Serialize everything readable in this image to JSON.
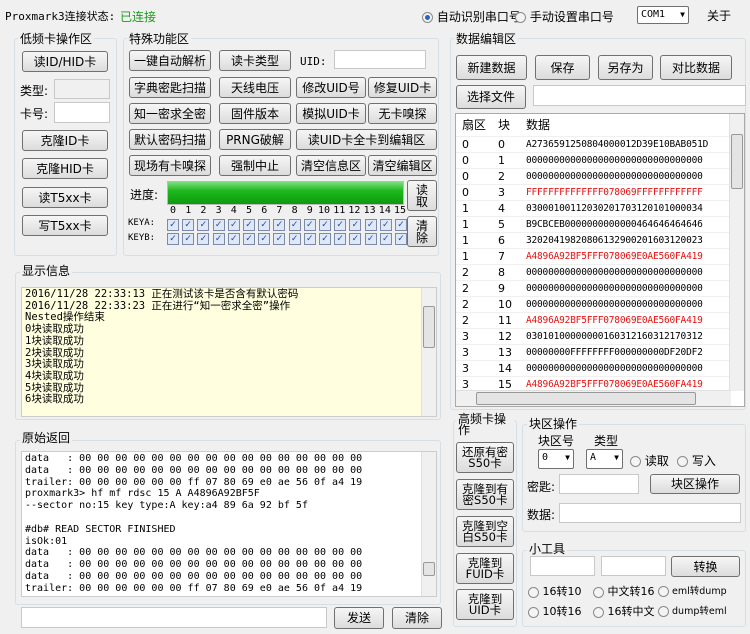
{
  "status": {
    "label": "Proxmark3连接状态:",
    "value": "已连接",
    "color": "#1c9a1c"
  },
  "port": {
    "auto_label": "自动识别串口号",
    "manual_label": "手动设置串口号",
    "selected": "COM1",
    "about": "关于"
  },
  "lf": {
    "title": "低频卡操作区",
    "read_id": "读ID/HID卡",
    "type_label": "类型:",
    "card_label": "卡号:",
    "clone_id": "克隆ID卡",
    "clone_hid": "克隆HID卡",
    "read_t5": "读T5xx卡",
    "write_t5": "写T5xx卡"
  },
  "special": {
    "title": "特殊功能区",
    "uid_label": "UID:",
    "buttons": [
      "一键自动解析",
      "读卡类型",
      "字典密匙扫描",
      "天线电压",
      "修改UID号",
      "修复UID卡",
      "知一密求全密",
      "固件版本",
      "模拟UID卡",
      "无卡嗅探",
      "默认密码扫描",
      "PRNG破解",
      "读UID卡全卡到编辑区",
      "现场有卡嗅探",
      "强制中止",
      "清空信息区",
      "清空编辑区"
    ],
    "progress_label": "进度:",
    "progress": 100,
    "read_btn": "读取",
    "clear_btn": "清除",
    "keya": "KEYA:",
    "keyb": "KEYB:",
    "sectors": [
      "0",
      "1",
      "2",
      "3",
      "4",
      "5",
      "6",
      "7",
      "8",
      "9",
      "10",
      "11",
      "12",
      "13",
      "14",
      "15"
    ]
  },
  "edit": {
    "title": "数据编辑区",
    "new": "新建数据",
    "save": "保存",
    "save_as": "另存为",
    "compare": "对比数据",
    "choose": "选择文件",
    "columns": [
      "扇区",
      "块",
      "数据"
    ],
    "rows": [
      [
        "0",
        "0",
        "A2736591250804000012D39E10BAB051D",
        false
      ],
      [
        "0",
        "1",
        "00000000000000000000000000000000",
        false
      ],
      [
        "0",
        "2",
        "00000000000000000000000000000000",
        false
      ],
      [
        "0",
        "3",
        "FFFFFFFFFFFFFF078069FFFFFFFFFFFF",
        true
      ],
      [
        "1",
        "4",
        "03000100112030201703120101000034",
        false
      ],
      [
        "1",
        "5",
        "B9CBCEB0000000000000464646464646",
        false
      ],
      [
        "1",
        "6",
        "32020419820806132900201603120023",
        false
      ],
      [
        "1",
        "7",
        "A4896A92BF5FFF078069E0AE560FA419",
        true
      ],
      [
        "2",
        "8",
        "00000000000000000000000000000000",
        false
      ],
      [
        "2",
        "9",
        "00000000000000000000000000000000",
        false
      ],
      [
        "2",
        "10",
        "00000000000000000000000000000000",
        false
      ],
      [
        "2",
        "11",
        "A4896A92BF5FFF078069E0AE560FA419",
        true
      ],
      [
        "3",
        "12",
        "03010100000000160312160312170312",
        false
      ],
      [
        "3",
        "13",
        "00000000FFFFFFFF000000000DF20DF2",
        false
      ],
      [
        "3",
        "14",
        "00000000000000000000000000000000",
        false
      ],
      [
        "3",
        "15",
        "A4896A92BF5FFF078069E0AE560FA419",
        true
      ]
    ]
  },
  "info": {
    "title": "显示信息",
    "lines": [
      "2016/11/28 22:33:13 正在测试该卡是否含有默认密码",
      "2016/11/28 22:33:23 正在进行“知一密求全密”操作",
      "Nested操作结束",
      "0块读取成功",
      "1块读取成功",
      "2块读取成功",
      "3块读取成功",
      "4块读取成功",
      "5块读取成功",
      "6块读取成功"
    ]
  },
  "raw": {
    "title": "原始返回",
    "lines": [
      "data   : 00 00 00 00 00 00 00 00 00 00 00 00 00 00 00 00",
      "data   : 00 00 00 00 00 00 00 00 00 00 00 00 00 00 00 00",
      "trailer: 00 00 00 00 00 00 ff 07 80 69 e0 ae 56 0f a4 19",
      "proxmark3> hf mf rdsc 15 A A4896A92BF5F",
      "--sector no:15 key type:A key:a4 89 6a 92 bf 5f",
      "",
      "#db# READ SECTOR FINISHED",
      "isOk:01",
      "data   : 00 00 00 00 00 00 00 00 00 00 00 00 00 00 00 00",
      "data   : 00 00 00 00 00 00 00 00 00 00 00 00 00 00 00 00",
      "data   : 00 00 00 00 00 00 00 00 00 00 00 00 00 00 00 00",
      "trailer: 00 00 00 00 00 00 ff 07 80 69 e0 ae 56 0f a4 19"
    ],
    "send": "发送",
    "clear": "清除"
  },
  "hf": {
    "title": "高频卡操作",
    "buttons": [
      "还原有密S50卡",
      "克隆到有密S50卡",
      "克隆到空白S50卡",
      "克隆到FUID卡",
      "克隆到UID卡"
    ]
  },
  "block": {
    "title": "块区操作",
    "block_no_label": "块区号",
    "type_label": "类型",
    "block_no": "0",
    "type": "A",
    "read": "读取",
    "write": "写入",
    "key_label": "密匙:",
    "op": "块区操作",
    "data_label": "数据:"
  },
  "tools": {
    "title": "小工具",
    "convert": "转换",
    "options": [
      "16转10",
      "中文转16",
      "eml转dump",
      "10转16",
      "16转中文",
      "dump转eml"
    ]
  }
}
